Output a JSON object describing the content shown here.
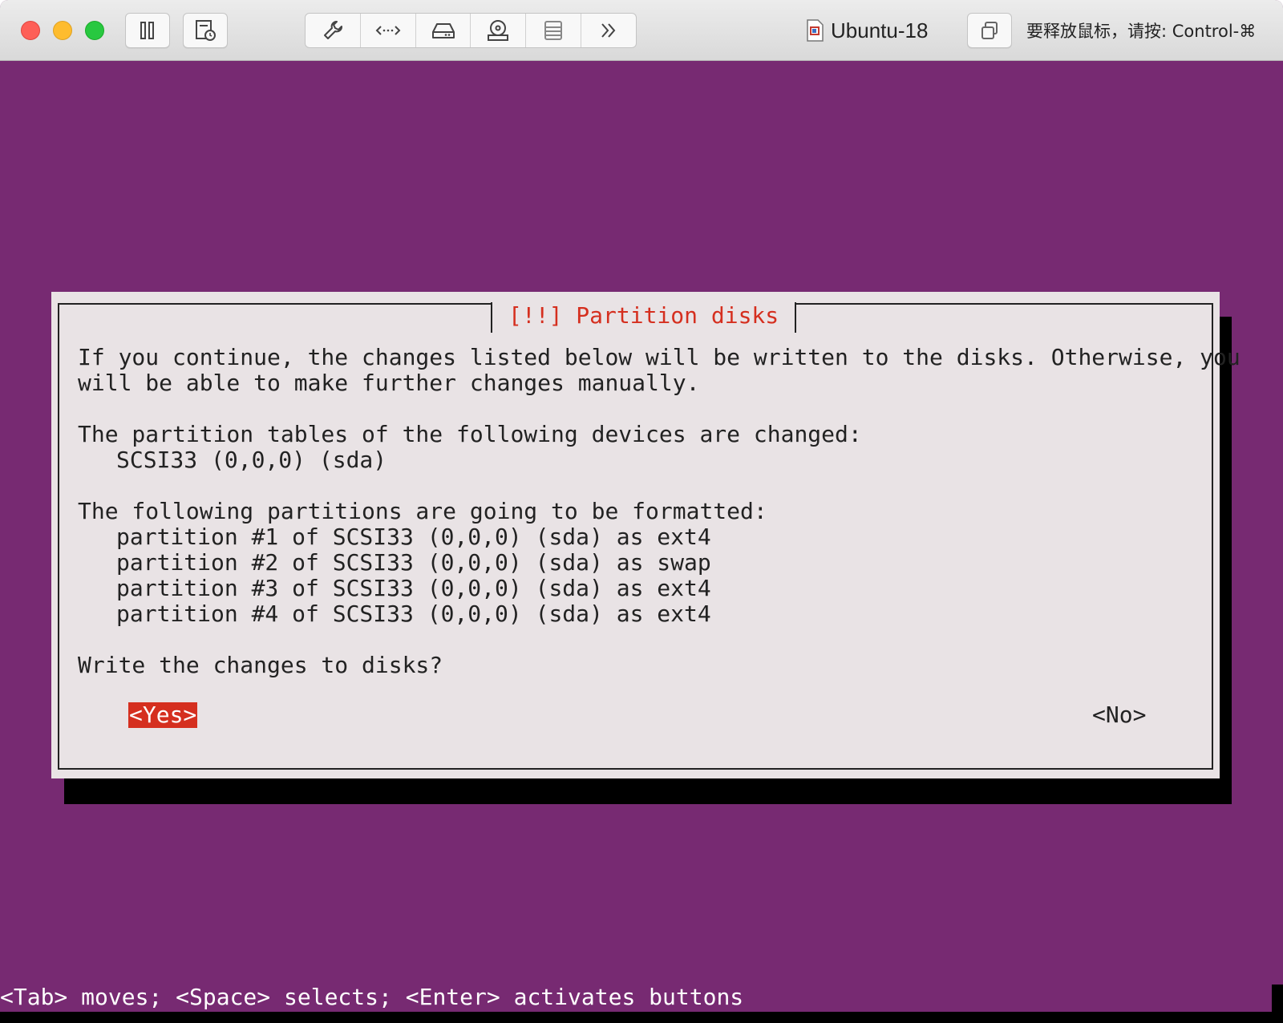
{
  "window": {
    "title": "Ubuntu-18",
    "release_hint": "要释放鼠标，请按: Control-⌘"
  },
  "toolbar": {
    "buttons": [
      {
        "name": "suspend",
        "icon": "pause-icon"
      },
      {
        "name": "snapshot",
        "icon": "snapshot-icon"
      },
      {
        "name": "settings",
        "icon": "wrench-icon"
      },
      {
        "name": "network",
        "icon": "network-arrows-icon"
      },
      {
        "name": "hard-disk",
        "icon": "hard-disk-icon"
      },
      {
        "name": "cd-dvd",
        "icon": "cd-dvd-icon"
      },
      {
        "name": "devices",
        "icon": "stack-icon"
      },
      {
        "name": "more",
        "icon": "double-chevron-right-icon"
      },
      {
        "name": "fullscreen",
        "icon": "windows-overlap-icon"
      }
    ]
  },
  "colors": {
    "desktop": "#772a72",
    "dialog_bg": "#e9e3e5",
    "accent_red": "#d52f1f"
  },
  "dialog": {
    "title": "[!!] Partition disks",
    "intro_line1": "If you continue, the changes listed below will be written to the disks. Otherwise, you",
    "intro_line2": "will be able to make further changes manually.",
    "devices_heading": "The partition tables of the following devices are changed:",
    "devices": [
      "SCSI33 (0,0,0) (sda)"
    ],
    "partitions_heading": "The following partitions are going to be formatted:",
    "partitions": [
      "partition #1 of SCSI33 (0,0,0) (sda) as ext4",
      "partition #2 of SCSI33 (0,0,0) (sda) as swap",
      "partition #3 of SCSI33 (0,0,0) (sda) as ext4",
      "partition #4 of SCSI33 (0,0,0) (sda) as ext4"
    ],
    "question": "Write the changes to disks?",
    "yes_label": "<Yes>",
    "no_label": "<No>"
  },
  "status_line": "<Tab> moves; <Space> selects; <Enter> activates buttons"
}
